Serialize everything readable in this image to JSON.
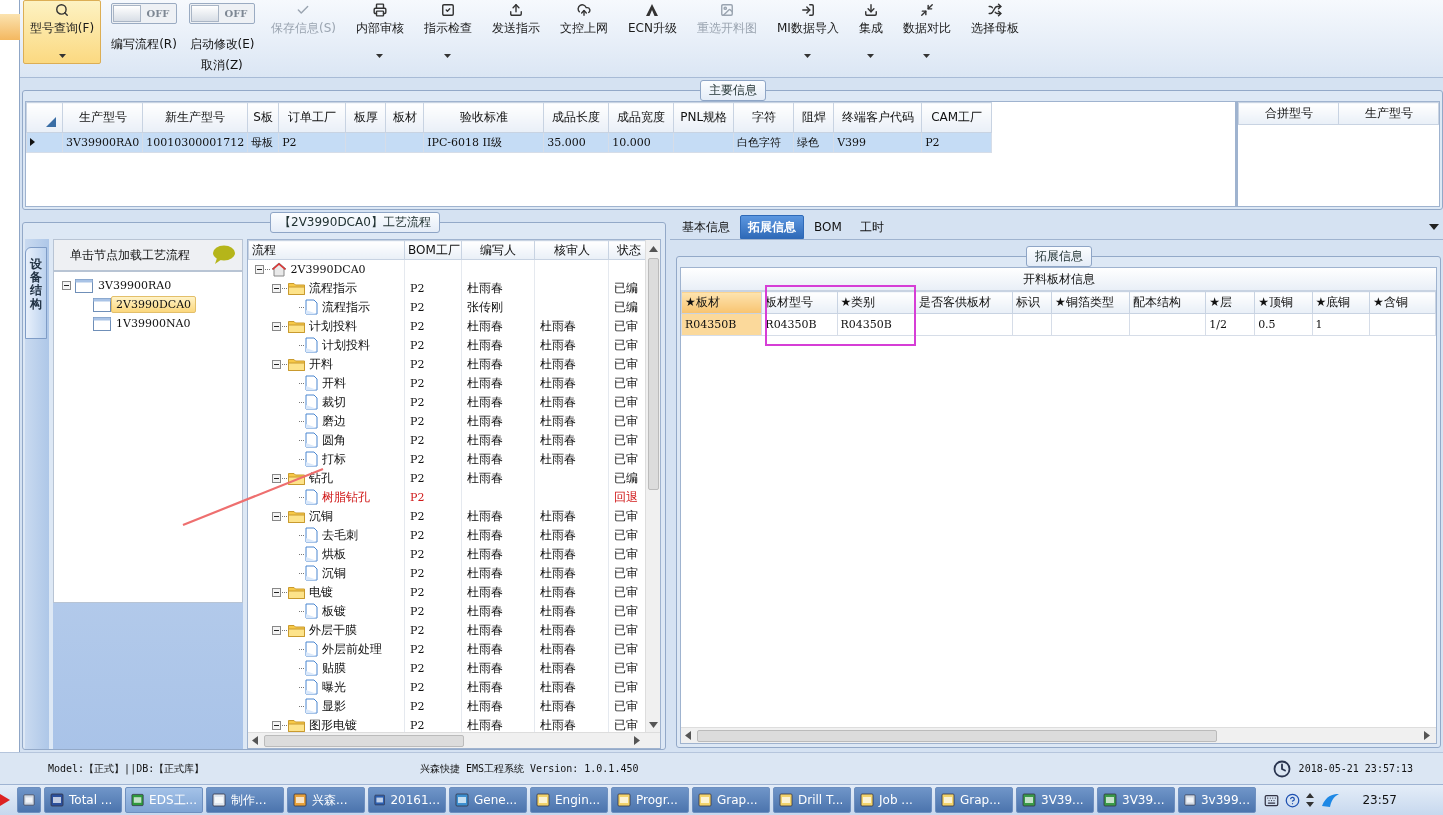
{
  "toolbar": {
    "items": [
      {
        "kind": "button",
        "label": "型号查询(F)",
        "selected": true,
        "disabled": false,
        "dropdown": true
      },
      {
        "kind": "toggle",
        "label": "编写流程(R)",
        "switch_text": "OFF",
        "on": false
      },
      {
        "kind": "toggle",
        "label": "启动修改(E)",
        "sublabel": "取消(Z)",
        "switch_text": "OFF",
        "on": false
      },
      {
        "kind": "button",
        "label": "保存信息(S)",
        "selected": false,
        "disabled": true,
        "dropdown": false
      },
      {
        "kind": "button",
        "label": "内部审核",
        "selected": false,
        "disabled": false,
        "dropdown": true
      },
      {
        "kind": "button",
        "label": "指示检查",
        "selected": false,
        "disabled": false,
        "dropdown": true
      },
      {
        "kind": "button",
        "label": "发送指示",
        "selected": false,
        "disabled": false,
        "dropdown": false
      },
      {
        "kind": "button",
        "label": "文控上网",
        "selected": false,
        "disabled": false,
        "dropdown": false
      },
      {
        "kind": "button",
        "label": "ECN升级",
        "selected": false,
        "disabled": false,
        "dropdown": false
      },
      {
        "kind": "button",
        "label": "重选开料图",
        "selected": false,
        "disabled": true,
        "dropdown": false
      },
      {
        "kind": "button",
        "label": "MI数据导入",
        "selected": false,
        "disabled": false,
        "dropdown": true
      },
      {
        "kind": "button",
        "label": "集成",
        "selected": false,
        "disabled": false,
        "dropdown": true
      },
      {
        "kind": "button",
        "label": "数据对比",
        "selected": false,
        "disabled": false,
        "dropdown": true
      },
      {
        "kind": "button",
        "label": "选择母板",
        "selected": false,
        "disabled": false,
        "dropdown": false
      }
    ]
  },
  "main_info": {
    "title": "主要信息",
    "table": {
      "columns": [
        "生产型号",
        "新生产型号",
        "S板",
        "订单工厂",
        "板厚",
        "板材",
        "验收标准",
        "成品长度",
        "成品宽度",
        "PNL规格",
        "字符",
        "阻焊",
        "终端客户代码",
        "CAM工厂"
      ],
      "rows": [
        {
          "selected": true,
          "cells": [
            "3V39900RA0",
            "10010300001712",
            "母板",
            "P2",
            null,
            null,
            "IPC-6018 II级",
            "35.000",
            "10.000",
            null,
            "白色字符",
            "绿色",
            "V399",
            "P2"
          ]
        }
      ]
    },
    "merge_table": {
      "columns": [
        "合拼型号",
        "生产型号"
      ]
    }
  },
  "process": {
    "title": "【2V3990DCA0】工艺流程",
    "side_tab": "设备结构",
    "device_tree": {
      "hint": "单击节点加载工艺流程",
      "nodes": [
        {
          "label": "3V39900RA0",
          "selected": false,
          "expanded": true,
          "children": [
            {
              "label": "2V3990DCA0",
              "selected": true
            },
            {
              "label": "1V39900NA0",
              "selected": false
            }
          ]
        }
      ]
    },
    "grid": {
      "columns": [
        "流程",
        "BOM工厂",
        "编写人",
        "核审人",
        "状态"
      ],
      "nodes": [
        {
          "kind": "root",
          "name": "2V3990DCA0",
          "expanded": true,
          "children": [
            {
              "kind": "folder",
              "name": "流程指示",
              "factory": "P2",
              "author": "杜雨春",
              "status": "已编",
              "returned": false,
              "expanded": true,
              "children": [
                {
                  "kind": "doc",
                  "name": "流程指示",
                  "factory": "P2",
                  "author": "张传刚",
                  "status": "已编",
                  "returned": false
                }
              ]
            },
            {
              "kind": "folder",
              "name": "计划投料",
              "factory": "P2",
              "author": "杜雨春",
              "reviewer": "杜雨春",
              "status": "已审",
              "returned": false,
              "expanded": true,
              "children": [
                {
                  "kind": "doc",
                  "name": "计划投料",
                  "factory": "P2",
                  "author": "杜雨春",
                  "reviewer": "杜雨春",
                  "status": "已审",
                  "returned": false
                }
              ]
            },
            {
              "kind": "folder",
              "name": "开料",
              "factory": "P2",
              "author": "杜雨春",
              "reviewer": "杜雨春",
              "status": "已审",
              "returned": false,
              "expanded": true,
              "children": [
                {
                  "kind": "doc",
                  "name": "开料",
                  "factory": "P2",
                  "author": "杜雨春",
                  "reviewer": "杜雨春",
                  "status": "已审",
                  "returned": false
                },
                {
                  "kind": "doc",
                  "name": "裁切",
                  "factory": "P2",
                  "author": "杜雨春",
                  "reviewer": "杜雨春",
                  "status": "已审",
                  "returned": false
                },
                {
                  "kind": "doc",
                  "name": "磨边",
                  "factory": "P2",
                  "author": "杜雨春",
                  "reviewer": "杜雨春",
                  "status": "已审",
                  "returned": false
                },
                {
                  "kind": "doc",
                  "name": "圆角",
                  "factory": "P2",
                  "author": "杜雨春",
                  "reviewer": "杜雨春",
                  "status": "已审",
                  "returned": false
                },
                {
                  "kind": "doc",
                  "name": "打标",
                  "factory": "P2",
                  "author": "杜雨春",
                  "reviewer": "杜雨春",
                  "status": "已审",
                  "returned": false
                }
              ]
            },
            {
              "kind": "folder",
              "name": "钻孔",
              "factory": "P2",
              "author": "杜雨春",
              "status": "已编",
              "returned": false,
              "expanded": true,
              "children": [
                {
                  "kind": "doc",
                  "name": "树脂钻孔",
                  "factory": "P2",
                  "status": "回退",
                  "returned": true
                }
              ]
            },
            {
              "kind": "folder",
              "name": "沉铜",
              "factory": "P2",
              "author": "杜雨春",
              "reviewer": "杜雨春",
              "status": "已审",
              "returned": false,
              "expanded": true,
              "children": [
                {
                  "kind": "doc",
                  "name": "去毛刺",
                  "factory": "P2",
                  "author": "杜雨春",
                  "reviewer": "杜雨春",
                  "status": "已审",
                  "returned": false
                },
                {
                  "kind": "doc",
                  "name": "烘板",
                  "factory": "P2",
                  "author": "杜雨春",
                  "reviewer": "杜雨春",
                  "status": "已审",
                  "returned": false
                },
                {
                  "kind": "doc",
                  "name": "沉铜",
                  "factory": "P2",
                  "author": "杜雨春",
                  "reviewer": "杜雨春",
                  "status": "已审",
                  "returned": false
                }
              ]
            },
            {
              "kind": "folder",
              "name": "电镀",
              "factory": "P2",
              "author": "杜雨春",
              "reviewer": "杜雨春",
              "status": "已审",
              "returned": false,
              "expanded": true,
              "children": [
                {
                  "kind": "doc",
                  "name": "板镀",
                  "factory": "P2",
                  "author": "杜雨春",
                  "reviewer": "杜雨春",
                  "status": "已审",
                  "returned": false
                }
              ]
            },
            {
              "kind": "folder",
              "name": "外层干膜",
              "factory": "P2",
              "author": "杜雨春",
              "reviewer": "杜雨春",
              "status": "已审",
              "returned": false,
              "expanded": true,
              "children": [
                {
                  "kind": "doc",
                  "name": "外层前处理",
                  "factory": "P2",
                  "author": "杜雨春",
                  "reviewer": "杜雨春",
                  "status": "已审",
                  "returned": false
                },
                {
                  "kind": "doc",
                  "name": "贴膜",
                  "factory": "P2",
                  "author": "杜雨春",
                  "reviewer": "杜雨春",
                  "status": "已审",
                  "returned": false
                },
                {
                  "kind": "doc",
                  "name": "曝光",
                  "factory": "P2",
                  "author": "杜雨春",
                  "reviewer": "杜雨春",
                  "status": "已审",
                  "returned": false
                },
                {
                  "kind": "doc",
                  "name": "显影",
                  "factory": "P2",
                  "author": "杜雨春",
                  "reviewer": "杜雨春",
                  "status": "已审",
                  "returned": false
                }
              ]
            },
            {
              "kind": "folder",
              "name": "图形电镀",
              "factory": "P2",
              "author": "杜雨春",
              "reviewer": "杜雨春",
              "status": "已审",
              "returned": false,
              "expanded": true
            }
          ]
        }
      ]
    }
  },
  "detail": {
    "tabs": [
      {
        "label": "基本信息",
        "selected": false
      },
      {
        "label": "拓展信息",
        "selected": true
      },
      {
        "label": "BOM",
        "selected": false
      },
      {
        "label": "工时",
        "selected": false
      }
    ],
    "group_title": "拓展信息",
    "grid_title": "开料板材信息",
    "columns": [
      {
        "label": "★板材",
        "selected": true
      },
      {
        "label": "板材型号",
        "selected": false
      },
      {
        "label": "★类别",
        "selected": false
      },
      {
        "label": "是否客供板材",
        "selected": false
      },
      {
        "label": "标识",
        "selected": false
      },
      {
        "label": "★铜箔类型",
        "selected": false
      },
      {
        "label": "配本结构",
        "selected": false
      },
      {
        "label": "★层",
        "selected": false
      },
      {
        "label": "★顶铜",
        "selected": false
      },
      {
        "label": "★底铜",
        "selected": false
      },
      {
        "label": "★含铜",
        "selected": false
      }
    ],
    "rows": [
      {
        "cells": [
          "R04350B",
          "R04350B",
          "R04350B",
          null,
          null,
          null,
          null,
          "1/2",
          "0.5",
          "1",
          null
        ]
      }
    ]
  },
  "status_bar": {
    "left": "Model:【正式】||DB:【正式库】",
    "center": "兴森快捷 EMS工程系统 Version: 1.0.1.450",
    "datetime": "2018-05-21 23:57:13"
  },
  "taskbar": {
    "items": [
      {
        "selected": false
      },
      {
        "label": "Total ...",
        "selected": false
      },
      {
        "label": "EDS工...",
        "selected": true
      },
      {
        "label": "制作...",
        "selected": false
      },
      {
        "label": "兴森...",
        "selected": false
      },
      {
        "label": "20161...",
        "selected": false
      },
      {
        "label": "Gene...",
        "selected": false
      },
      {
        "label": "Engin...",
        "selected": false
      },
      {
        "label": "Progr...",
        "selected": false
      },
      {
        "label": "Grap...",
        "selected": false
      },
      {
        "label": "Drill T...",
        "selected": false
      },
      {
        "label": "Job ...",
        "selected": false
      },
      {
        "label": "Grap...",
        "selected": false
      },
      {
        "label": "3V39...",
        "selected": false
      },
      {
        "label": "3V39...",
        "selected": false
      },
      {
        "label": "3v399...",
        "selected": false
      }
    ],
    "clock": "23:57"
  }
}
